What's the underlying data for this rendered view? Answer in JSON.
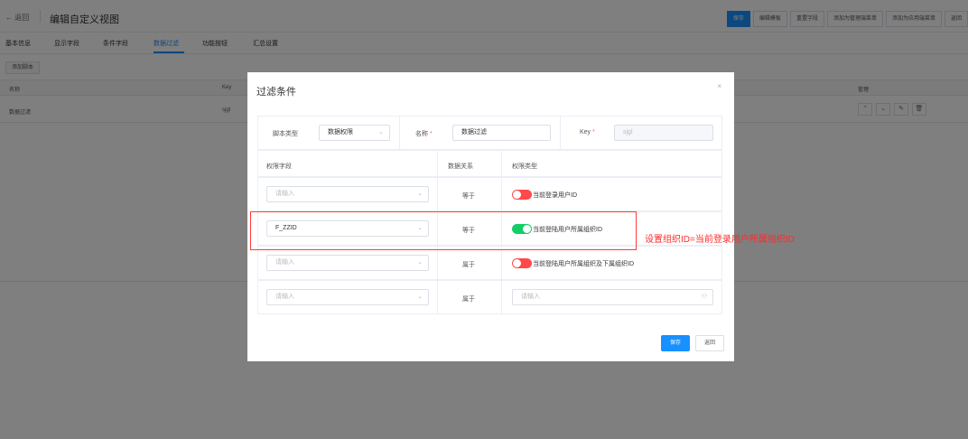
{
  "header": {
    "back_label": "← 返回",
    "title": "编辑自定义视图",
    "actions": [
      "保存",
      "编辑模板",
      "重置字段",
      "添加为管理端菜单",
      "添加为应用端菜单",
      "返回"
    ]
  },
  "tabs": [
    "基本信息",
    "显示字段",
    "条件字段",
    "数据过滤",
    "功能按钮",
    "汇总设置"
  ],
  "active_tab": "数据过滤",
  "toolbar": {
    "add_script": "添加脚本"
  },
  "table": {
    "columns": {
      "name": "名称",
      "key": "Key",
      "manage": "管理"
    },
    "row": {
      "name": "数据过滤",
      "key": "sjgl"
    },
    "row_icons": [
      "chevron-up-icon",
      "chevron-down-icon",
      "edit-icon",
      "delete-icon"
    ]
  },
  "modal": {
    "title": "过滤条件",
    "close": "×",
    "script_type_label": "脚本类型",
    "script_type_value": "数据权限",
    "name_label": "名称",
    "name_value": "数据过滤",
    "key_label": "Key",
    "key_value": "sjgl",
    "columns": {
      "field": "权限字段",
      "relation": "数据关系",
      "type": "权限类型"
    },
    "rows": [
      {
        "field_placeholder": "请输入",
        "field_value": "",
        "relation": "等于",
        "toggle_on": false,
        "type_label": "当前登录用户ID"
      },
      {
        "field_placeholder": "",
        "field_value": "F_ZZID",
        "relation": "等于",
        "toggle_on": true,
        "type_label": "当前登陆用户所属组织ID"
      },
      {
        "field_placeholder": "请输入",
        "field_value": "",
        "relation": "属于",
        "toggle_on": false,
        "type_label": "当前登陆用户所属组织及下属组织ID"
      },
      {
        "field_placeholder": "请输入",
        "field_value": "",
        "relation": "属于",
        "type_input_placeholder": "请输入"
      }
    ],
    "save": "保存",
    "back": "返回"
  },
  "annotation": "设置组织ID=当前登录用户所属组织ID",
  "colors": {
    "primary": "#1890ff",
    "switch_on": "#13ce66",
    "switch_off": "#ff4949",
    "annotation": "#ff2a2a"
  }
}
